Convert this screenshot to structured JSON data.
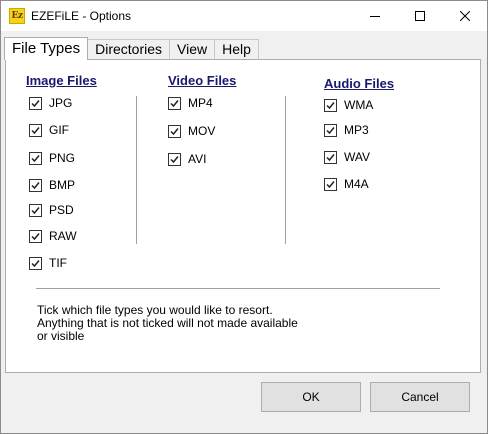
{
  "window": {
    "title": "EZEFiLE - Options",
    "icon_text": "Ez",
    "controls": [
      "minimize-icon",
      "maximize-icon",
      "close-icon"
    ]
  },
  "tabs": [
    {
      "label": "File Types",
      "active": true
    },
    {
      "label": "Directories",
      "active": false
    },
    {
      "label": "View",
      "active": false
    },
    {
      "label": "Help",
      "active": false
    }
  ],
  "groups": {
    "image": {
      "heading": "Image Files",
      "items": [
        {
          "label": "JPG",
          "checked": true
        },
        {
          "label": "GIF",
          "checked": true
        },
        {
          "label": "PNG",
          "checked": true
        },
        {
          "label": "BMP",
          "checked": true
        },
        {
          "label": "PSD",
          "checked": true
        },
        {
          "label": "RAW",
          "checked": true
        },
        {
          "label": "TIF",
          "checked": true
        }
      ]
    },
    "video": {
      "heading": "Video Files",
      "items": [
        {
          "label": "MP4",
          "checked": true
        },
        {
          "label": "MOV",
          "checked": true
        },
        {
          "label": "AVI",
          "checked": true
        }
      ]
    },
    "audio": {
      "heading": "Audio Files",
      "items": [
        {
          "label": "WMA",
          "checked": true
        },
        {
          "label": "MP3",
          "checked": true
        },
        {
          "label": "WAV",
          "checked": true
        },
        {
          "label": "M4A",
          "checked": true
        }
      ]
    }
  },
  "hint": {
    "line1": "Tick which file types you would like to resort.",
    "line2": "Anything that is not ticked will not made available",
    "line3": "or visible"
  },
  "buttons": {
    "ok": "OK",
    "cancel": "Cancel"
  },
  "colors": {
    "heading": "#18186e",
    "icon": "#f6d21c"
  }
}
